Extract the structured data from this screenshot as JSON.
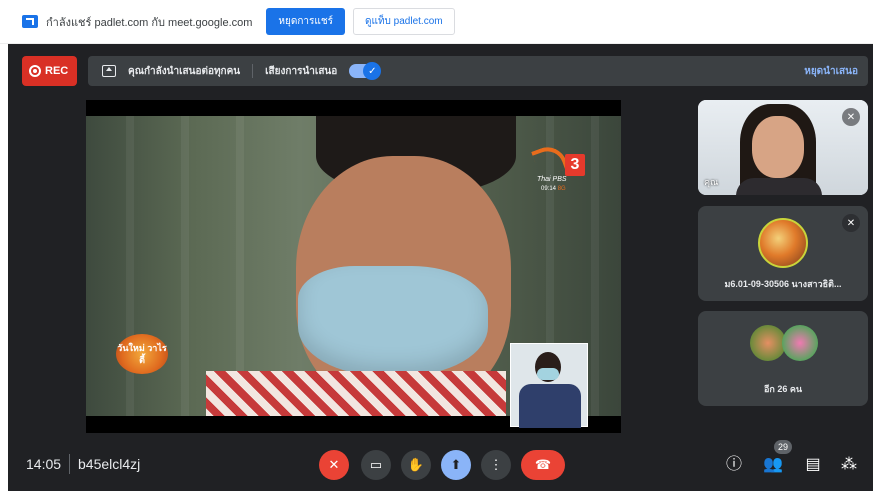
{
  "share_bar": {
    "text": "กำลังแชร์ padlet.com กับ meet.google.com",
    "stop_share_label": "หยุดการแชร์",
    "view_label": "ดูแท็บ padlet.com"
  },
  "meet": {
    "rec_label": "REC",
    "presenting_text": "คุณกำลังนำเสนอต่อทุกคน",
    "presenting_audio_label": "เสียงการนำเสนอ",
    "presenting_audio_on": true,
    "stop_presenting_label": "หยุดนำเสนอ",
    "time": "14:05",
    "meeting_code": "b45elcl4zj"
  },
  "main_video": {
    "channel_name": "Thai PBS",
    "channel_number": "3",
    "channel_time": "09:14",
    "channel_hd": "8G",
    "show_logo_text": "วันใหม่ วาไรตี้"
  },
  "participants": [
    {
      "label": "คุณ",
      "muted": true
    },
    {
      "name": "ม6.01-09-30506 นางสาวธิติ...",
      "muted": true
    },
    {
      "others_label": "อีก 26 คน"
    }
  ],
  "controls": {
    "people_count": "29"
  },
  "colors": {
    "accent": "#1a73e8",
    "danger": "#ea4335",
    "meet_bg": "#202124",
    "tile_bg": "#3c4043",
    "link_blue": "#8ab4f8"
  }
}
